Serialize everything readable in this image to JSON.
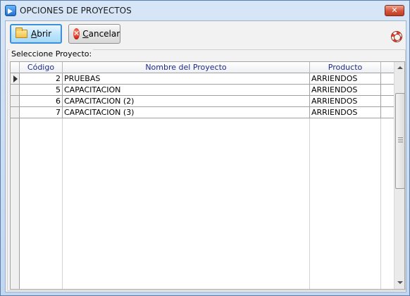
{
  "window": {
    "title": "OPCIONES DE PROYECTOS",
    "close_label": "✕"
  },
  "toolbar": {
    "open": {
      "mnemonic": "A",
      "rest": "brir"
    },
    "cancel": {
      "mnemonic": "C",
      "rest": "ancelar"
    }
  },
  "group": {
    "label": "Seleccione Proyecto:"
  },
  "grid": {
    "headers": {
      "code": "Código",
      "name": "Nombre del Proyecto",
      "product": "Producto"
    },
    "rows": [
      {
        "code": "2",
        "name": "PRUEBAS",
        "product": "ARRIENDOS"
      },
      {
        "code": "5",
        "name": "CAPACITACION",
        "product": "ARRIENDOS"
      },
      {
        "code": "6",
        "name": "CAPACITACION (2)",
        "product": "ARRIENDOS"
      },
      {
        "code": "7",
        "name": "CAPACITACION (3)",
        "product": "ARRIENDOS"
      }
    ],
    "current_row_index": 0
  },
  "icons": {
    "app": "app-icon",
    "open": "folder-icon",
    "cancel": "cancel-icon",
    "help": "help-lifebuoy-icon"
  }
}
